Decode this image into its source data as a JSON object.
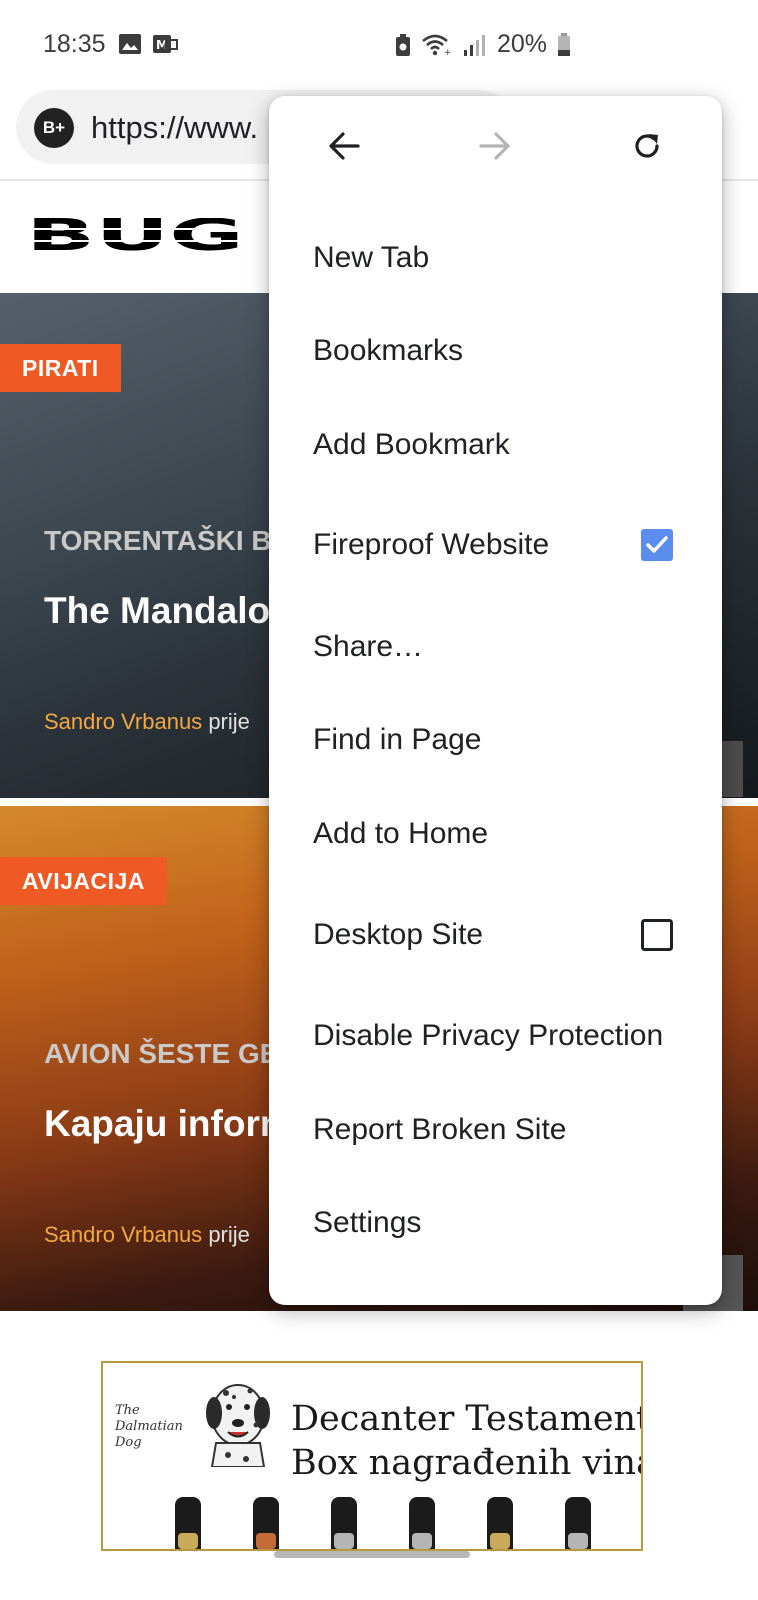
{
  "status_bar": {
    "time": "18:35",
    "battery": "20%",
    "icons": [
      "image-icon",
      "voicemail-icon",
      "battery-saver-icon",
      "wifi-icon",
      "signal-icon",
      "battery-icon"
    ]
  },
  "browser": {
    "url": "https://www.",
    "site_badge": "B+"
  },
  "site": {
    "logo_text": "BUG"
  },
  "articles": [
    {
      "category": "PIRATI",
      "kicker": "TORRENTAŠKI B",
      "headline": "The Mandalo piratizirana s",
      "author": "Sandro Vrbanus",
      "time": "prije"
    },
    {
      "category": "AVIJACIJA",
      "kicker": "AVION ŠESTE GE",
      "headline": "Kapaju inform borbenom av",
      "author": "Sandro Vrbanus",
      "time": "prije"
    }
  ],
  "ad": {
    "brand_script": "The Dalmatian Dog",
    "title_line1": "Decanter Testament",
    "title_line2": "Box nagrađenih vina!",
    "bottle_label_colors": [
      "#c9a95a",
      "#c46b3a",
      "#b5b5b5",
      "#b5b5b5",
      "#c9a95a",
      "#b5b5b5"
    ]
  },
  "menu": {
    "nav": {
      "back_icon": "arrow-left-icon",
      "forward_icon": "arrow-right-icon",
      "refresh_icon": "refresh-icon"
    },
    "items": [
      {
        "label": "New Tab"
      },
      {
        "label": "Bookmarks"
      },
      {
        "label": "Add Bookmark"
      },
      {
        "label": "Fireproof Website",
        "checkbox": true,
        "checked": true
      },
      {
        "label": "Share…"
      },
      {
        "label": "Find in Page"
      },
      {
        "label": "Add to Home"
      },
      {
        "label": "Desktop Site",
        "checkbox": true,
        "checked": false
      },
      {
        "label": "Disable Privacy Protection"
      },
      {
        "label": "Report Broken Site"
      },
      {
        "label": "Settings"
      }
    ]
  },
  "colors": {
    "accent_tag": "#ef5a24",
    "author": "#f3a940",
    "checkbox_checked": "#5b8def",
    "ad_border": "#b8993e"
  }
}
